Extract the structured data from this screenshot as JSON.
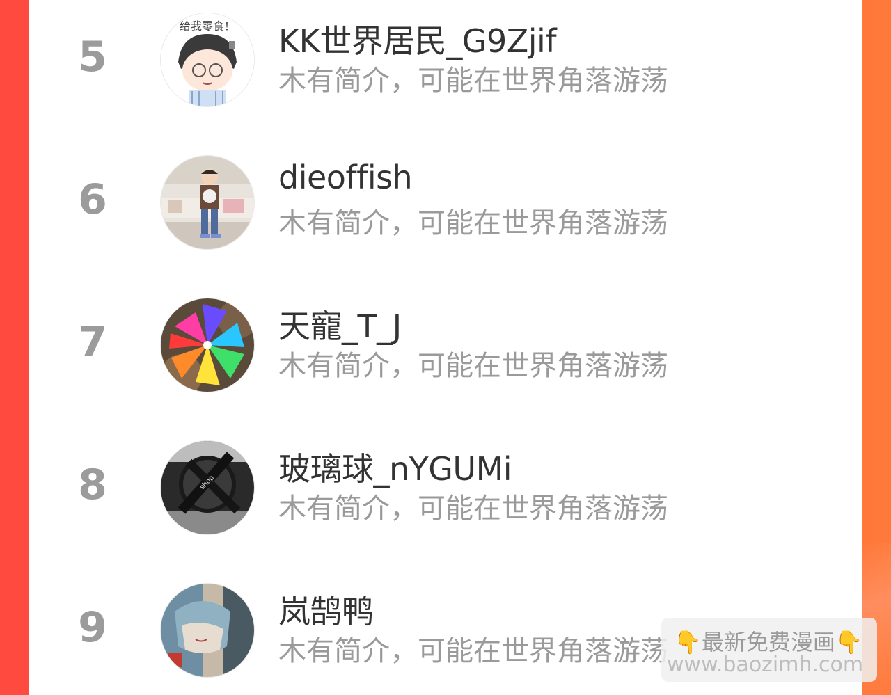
{
  "list": {
    "rows": [
      {
        "rank": "5",
        "name": "KK世界居民_G9Zjif",
        "desc": "木有简介，可能在世界角落游荡",
        "avatar": "cartoon-boy-avatar"
      },
      {
        "rank": "6",
        "name": "dieoffish",
        "desc": "木有简介，可能在世界角落游荡",
        "avatar": "child-photo-avatar"
      },
      {
        "rank": "7",
        "name": "天寵_T_J",
        "desc": "木有简介，可能在世界角落游荡",
        "avatar": "pinwheel-avatar"
      },
      {
        "rank": "8",
        "name": "玻璃球_nYGUMi",
        "desc": "木有简介，可能在世界角落游荡",
        "avatar": "bw-photo-avatar"
      },
      {
        "rank": "9",
        "name": "岚鹄鸭",
        "desc": "木有简介，可能在世界角落游荡",
        "avatar": "anime-illustration-avatar"
      }
    ]
  },
  "watermark": {
    "hand_icon": "👇",
    "title": "最新免费漫画",
    "url": "www.baozimh.com"
  },
  "colors": {
    "background_left": "#ff4a3f",
    "background_right": "#ff7a3a",
    "rank": "#9b9b9b",
    "name": "#333333",
    "desc": "#9a9a9a"
  }
}
